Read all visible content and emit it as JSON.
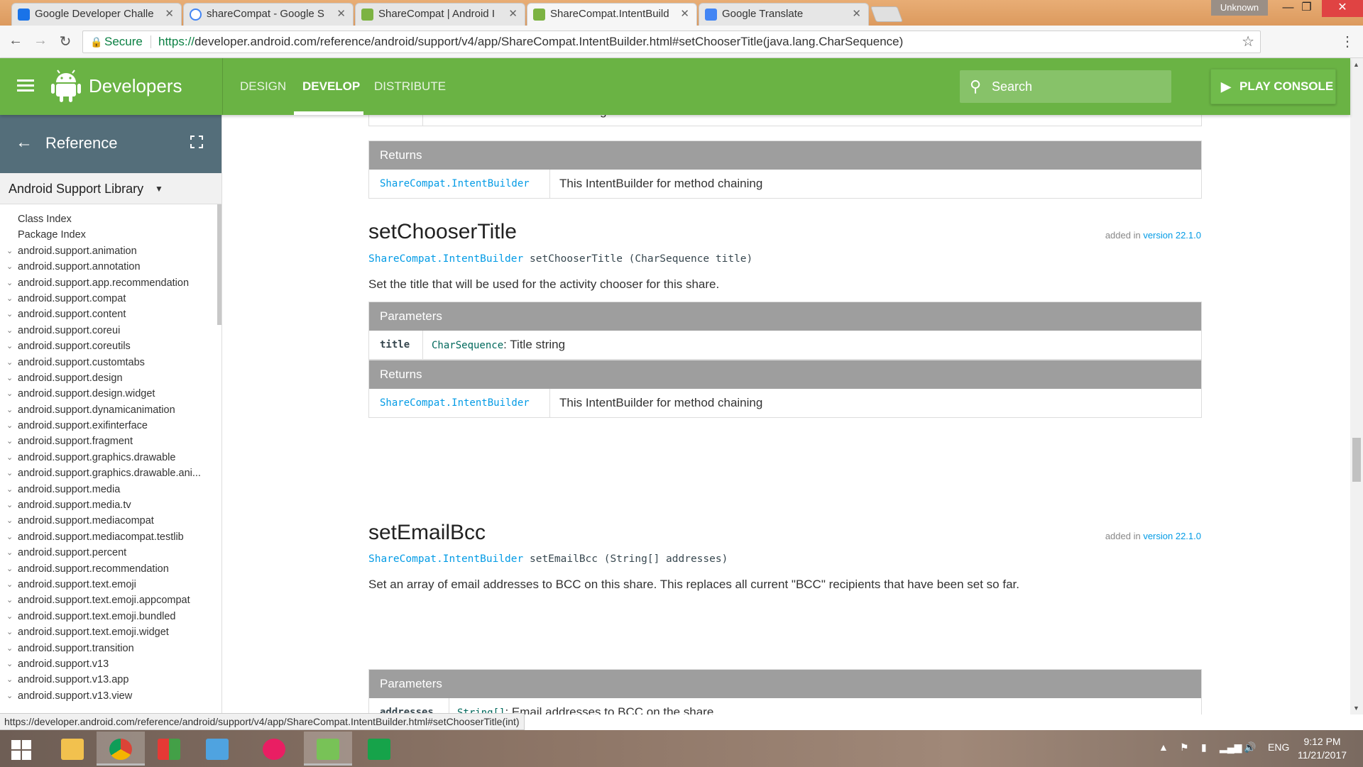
{
  "browser": {
    "tabs": [
      {
        "title": "Google Developer Challe",
        "icon_color": "#1a73e8"
      },
      {
        "title": "shareCompat - Google S",
        "icon_color": "#4285f4"
      },
      {
        "title": "ShareCompat | Android I",
        "icon_color": "#7cb342"
      },
      {
        "title": "ShareCompat.IntentBuild",
        "icon_color": "#7cb342"
      },
      {
        "title": "Google Translate",
        "icon_color": "#4285f4"
      }
    ],
    "profile_badge": "Unknown",
    "secure_label": "Secure",
    "url_scheme": "https://",
    "url_rest": "developer.android.com/reference/android/support/v4/app/ShareCompat.IntentBuilder.html#setChooserTitle(java.lang.CharSequence)",
    "status_url": "https://developer.android.com/reference/android/support/v4/app/ShareCompat.IntentBuilder.html#setChooserTitle(int)"
  },
  "header": {
    "brand": "Developers",
    "nav": [
      "DESIGN",
      "DEVELOP",
      "DISTRIBUTE"
    ],
    "search_placeholder": "Search",
    "play_console": "PLAY CONSOLE",
    "brand_color": "#6ab344"
  },
  "sidebar": {
    "title": "Reference",
    "library": "Android Support Library",
    "links": [
      "Class Index",
      "Package Index"
    ],
    "packages": [
      "android.support.animation",
      "android.support.annotation",
      "android.support.app.recommendation",
      "android.support.compat",
      "android.support.content",
      "android.support.coreui",
      "android.support.coreutils",
      "android.support.customtabs",
      "android.support.design",
      "android.support.design.widget",
      "android.support.dynamicanimation",
      "android.support.exifinterface",
      "android.support.fragment",
      "android.support.graphics.drawable",
      "android.support.graphics.drawable.ani...",
      "android.support.media",
      "android.support.media.tv",
      "android.support.mediacompat",
      "android.support.mediacompat.testlib",
      "android.support.percent",
      "android.support.recommendation",
      "android.support.text.emoji",
      "android.support.text.emoji.appcompat",
      "android.support.text.emoji.bundled",
      "android.support.text.emoji.widget",
      "android.support.transition",
      "android.support.v13",
      "android.support.v13.app",
      "android.support.v13.view"
    ]
  },
  "content": {
    "top_partial_row": {
      "name": "resId",
      "desc": "int: Resource ID of the title string to use"
    },
    "returns_label": "Returns",
    "parameters_label": "Parameters",
    "returns_type": "ShareCompat.IntentBuilder",
    "returns_desc": "This IntentBuilder for method chaining",
    "added_in": "added in",
    "added_version": "version 22.1.0",
    "methods": [
      {
        "name": "setChooserTitle",
        "sig_type": "ShareCompat.IntentBuilder",
        "sig_rest": "setChooserTitle (CharSequence title)",
        "description": "Set the title that will be used for the activity chooser for this share.",
        "param_name": "title",
        "param_type": "CharSequence",
        "param_desc": ": Title string"
      },
      {
        "name": "setEmailBcc",
        "sig_type": "ShareCompat.IntentBuilder",
        "sig_rest": "setEmailBcc (String[] addresses)",
        "description": "Set an array of email addresses to BCC on this share. This replaces all current \"BCC\" recipients that have been set so far.",
        "param_name": "addresses",
        "param_type": "String[]",
        "param_desc": ": Email addresses to BCC on the share"
      }
    ]
  },
  "taskbar": {
    "language": "ENG",
    "time": "9:12 PM",
    "date": "11/21/2017"
  }
}
